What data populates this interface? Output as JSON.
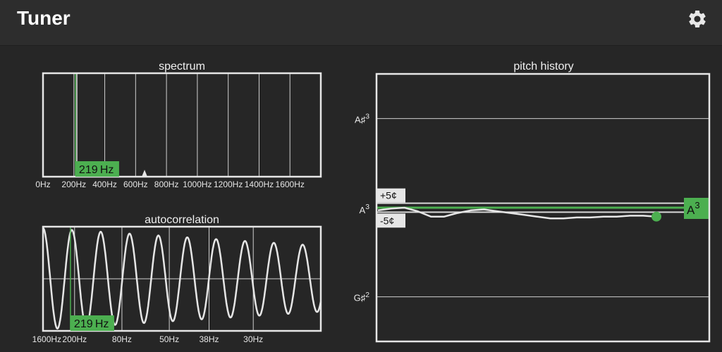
{
  "app": {
    "title": "Tuner"
  },
  "toolbar": {
    "settings_icon": "gear-icon"
  },
  "colors": {
    "background": "#262626",
    "appbar": "#2d2d2d",
    "accent": "#4caf50",
    "line": "#e6e6e6",
    "grid": "#d0d0d0"
  },
  "spectrum": {
    "title": "spectrum",
    "detected_label": "219 Hz",
    "detected_hz": 219,
    "x_range_hz": [
      0,
      1800
    ],
    "x_ticks": [
      "0Hz",
      "200Hz",
      "400Hz",
      "600Hz",
      "800Hz",
      "1000Hz",
      "1200Hz",
      "1400Hz",
      "1600Hz"
    ],
    "x_tick_values": [
      0,
      200,
      400,
      600,
      800,
      1000,
      1200,
      1400,
      1600
    ],
    "peaks": [
      {
        "hz": 219,
        "amplitude": 1.0
      },
      {
        "hz": 658,
        "amplitude": 0.04
      }
    ]
  },
  "autocorrelation": {
    "title": "autocorrelation",
    "detected_label": "219 Hz",
    "x_ticks": [
      "1600Hz",
      "200Hz",
      "80Hz",
      "50Hz",
      "38Hz",
      "30Hz"
    ],
    "x_tick_lags_ms": [
      0.6,
      5,
      12.5,
      20,
      26.3,
      33.3
    ],
    "lag_range_ms": [
      0,
      44
    ],
    "detected_period_ms": 4.57
  },
  "pitch_history": {
    "title": "pitch history",
    "target_note": "A",
    "target_octave": "3",
    "upper_note": "A♯",
    "upper_octave": "3",
    "lower_note": "G♯",
    "lower_octave": "2",
    "tolerance_plus": "+5¢",
    "tolerance_minus": "-5¢",
    "cents_range": [
      -150,
      150
    ],
    "history_cents": [
      -3,
      -1,
      0,
      -4,
      -10,
      -10,
      -6,
      -3,
      -2,
      -4,
      -6,
      -8,
      -10,
      -12,
      -12,
      -11,
      -11,
      -10,
      -10,
      -9,
      -9,
      -10
    ]
  }
}
